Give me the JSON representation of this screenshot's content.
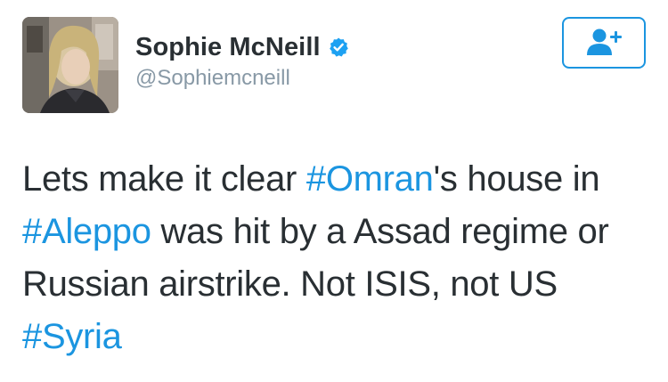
{
  "author": {
    "display_name": "Sophie McNeill",
    "handle": "@Sophiemcneill",
    "verified": true
  },
  "follow_button": {
    "icon": "add-user-icon"
  },
  "tweet": {
    "segments": [
      {
        "type": "text",
        "text": "Lets make it clear "
      },
      {
        "type": "hashtag",
        "text": "#Omran"
      },
      {
        "type": "text",
        "text": "'s house in "
      },
      {
        "type": "hashtag",
        "text": "#Aleppo"
      },
      {
        "type": "text",
        "text": " was hit by a Assad regime or Russian airstrike. Not ISIS, not US "
      },
      {
        "type": "hashtag",
        "text": "#Syria"
      }
    ]
  },
  "colors": {
    "link": "#1b95e0",
    "text": "#292f33",
    "secondary": "#8899a6"
  }
}
